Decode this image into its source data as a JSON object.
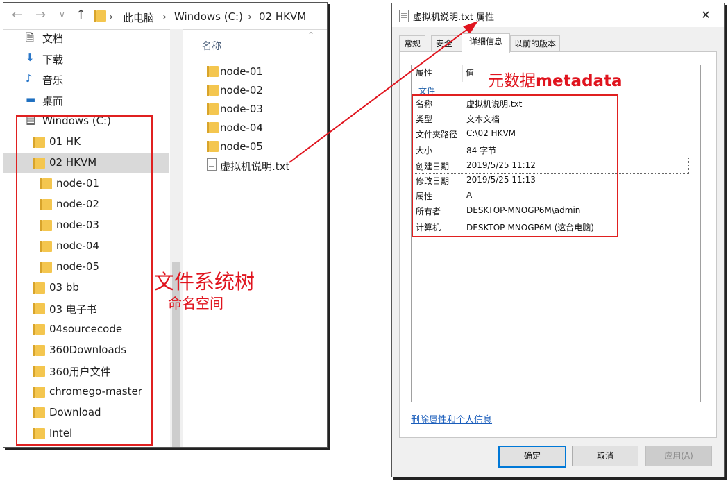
{
  "explorer": {
    "breadcrumb": [
      "此电脑",
      "Windows (C:)",
      "02 HKVM"
    ],
    "tree": [
      {
        "label": "文档",
        "icon": "document-icon"
      },
      {
        "label": "下载",
        "icon": "download-icon"
      },
      {
        "label": "音乐",
        "icon": "music-icon"
      },
      {
        "label": "桌面",
        "icon": "desktop-icon"
      },
      {
        "label": "Windows (C:)",
        "icon": "drive-icon"
      },
      {
        "label": "01 HK",
        "icon": "folder-icon"
      },
      {
        "label": "02 HKVM",
        "icon": "folder-icon",
        "selected": true
      },
      {
        "label": "node-01",
        "icon": "folder-icon"
      },
      {
        "label": "node-02",
        "icon": "folder-icon"
      },
      {
        "label": "node-03",
        "icon": "folder-icon"
      },
      {
        "label": "node-04",
        "icon": "folder-icon"
      },
      {
        "label": "node-05",
        "icon": "folder-icon"
      },
      {
        "label": "03 bb",
        "icon": "folder-icon"
      },
      {
        "label": "03 电子书",
        "icon": "folder-icon"
      },
      {
        "label": "04sourcecode",
        "icon": "folder-icon"
      },
      {
        "label": "360Downloads",
        "icon": "folder-icon"
      },
      {
        "label": "360用户文件",
        "icon": "folder-icon"
      },
      {
        "label": "chromego-master",
        "icon": "folder-icon"
      },
      {
        "label": "Download",
        "icon": "folder-icon"
      },
      {
        "label": "Intel",
        "icon": "folder-icon"
      }
    ],
    "column_header": "名称",
    "files": [
      {
        "label": "node-01",
        "icon": "folder-icon"
      },
      {
        "label": "node-02",
        "icon": "folder-icon"
      },
      {
        "label": "node-03",
        "icon": "folder-icon"
      },
      {
        "label": "node-04",
        "icon": "folder-icon"
      },
      {
        "label": "node-05",
        "icon": "folder-icon"
      },
      {
        "label": "虚拟机说明.txt",
        "icon": "text-file-icon"
      }
    ]
  },
  "annotations": {
    "tree_title": "文件系统树",
    "tree_subtitle": "命名空间",
    "meta_prefix": "元数据",
    "meta_suffix": "metadata",
    "color": "#e0141e"
  },
  "properties": {
    "title": "虚拟机说明.txt 属性",
    "tabs": [
      "常规",
      "安全",
      "详细信息",
      "以前的版本"
    ],
    "active_tab": "详细信息",
    "header_property": "属性",
    "header_value": "值",
    "group": "文件",
    "rows": [
      {
        "name": "名称",
        "value": "虚拟机说明.txt"
      },
      {
        "name": "类型",
        "value": "文本文档"
      },
      {
        "name": "文件夹路径",
        "value": "C:\\02 HKVM"
      },
      {
        "name": "大小",
        "value": "84 字节"
      },
      {
        "name": "创建日期",
        "value": "2019/5/25 11:12"
      },
      {
        "name": "修改日期",
        "value": "2019/5/25 11:13"
      },
      {
        "name": "属性",
        "value": "A"
      },
      {
        "name": "所有者",
        "value": "DESKTOP-MNOGP6M\\admin"
      },
      {
        "name": "计算机",
        "value": "DESKTOP-MNOGP6M (这台电脑)"
      }
    ],
    "remove_link": "删除属性和个人信息",
    "buttons": {
      "ok": "确定",
      "cancel": "取消",
      "apply": "应用(A)"
    }
  }
}
